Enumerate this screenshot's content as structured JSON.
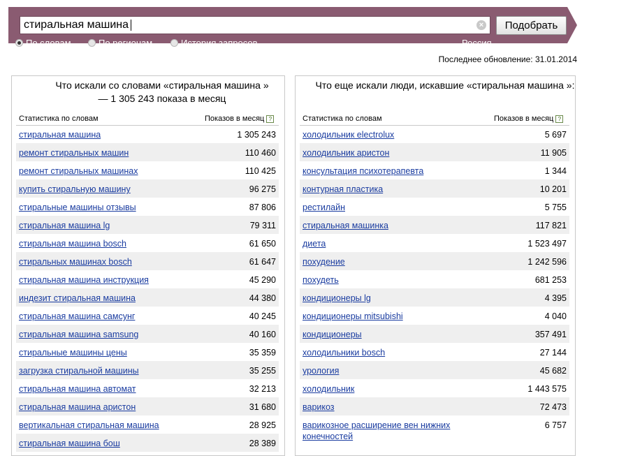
{
  "search": {
    "query": "стиральная машина",
    "submit_label": "Подобрать",
    "clear_glyph": "×",
    "modes": [
      {
        "label": "По словам",
        "checked": true
      },
      {
        "label": "По регионам",
        "checked": false
      },
      {
        "label": "История запросов",
        "checked": false
      }
    ],
    "region": "Россия"
  },
  "last_update": "Последнее обновление: 31.01.2014",
  "left_panel": {
    "title": "Что искали со словами «стиральная машина » — 1 305 243 показа в месяц",
    "col_words": "Статистика по словам",
    "col_count": "Показов в месяц",
    "help_glyph": "?",
    "rows": [
      {
        "phrase": "стиральная машина",
        "count": "1 305 243"
      },
      {
        "phrase": "ремонт стиральных машин",
        "count": "110 460"
      },
      {
        "phrase": "ремонт стиральных машинах",
        "count": "110 425"
      },
      {
        "phrase": "купить стиральную машину",
        "count": "96 275"
      },
      {
        "phrase": "стиральные машины отзывы",
        "count": "87 806"
      },
      {
        "phrase": "стиральная машина lg",
        "count": "79 311"
      },
      {
        "phrase": "стиральная машина bosch",
        "count": "61 650"
      },
      {
        "phrase": "стиральных машинах bosch",
        "count": "61 647"
      },
      {
        "phrase": "стиральная машина инструкция",
        "count": "45 290"
      },
      {
        "phrase": "индезит стиральная машина",
        "count": "44 380"
      },
      {
        "phrase": "стиральная машина самсунг",
        "count": "40 245"
      },
      {
        "phrase": "стиральная машина samsung",
        "count": "40 160"
      },
      {
        "phrase": "стиральные машины цены",
        "count": "35 359"
      },
      {
        "phrase": "загрузка стиральной машины",
        "count": "35 255"
      },
      {
        "phrase": "стиральная машина автомат",
        "count": "32 213"
      },
      {
        "phrase": "стиральная машина аристон",
        "count": "31 680"
      },
      {
        "phrase": "вертикальная стиральная машина",
        "count": "28 925"
      },
      {
        "phrase": "стиральная машина бош",
        "count": "28 389"
      }
    ]
  },
  "right_panel": {
    "title": "Что еще искали люди, искавшие «стиральная машина »:",
    "col_words": "Статистика по словам",
    "col_count": "Показов в месяц",
    "help_glyph": "?",
    "rows": [
      {
        "phrase": "холодильник electrolux",
        "count": "5 697"
      },
      {
        "phrase": "холодильник аристон",
        "count": "11 905"
      },
      {
        "phrase": "консультация психотерапевта",
        "count": "1 344"
      },
      {
        "phrase": "контурная пластика",
        "count": "10 201"
      },
      {
        "phrase": "рестилайн",
        "count": "5 755"
      },
      {
        "phrase": "стиральная машинка",
        "count": "117 821"
      },
      {
        "phrase": "диета",
        "count": "1 523 497"
      },
      {
        "phrase": "похудение",
        "count": "1 242 596"
      },
      {
        "phrase": "похудеть",
        "count": "681 253"
      },
      {
        "phrase": "кондиционеры lg",
        "count": "4 395"
      },
      {
        "phrase": "кондиционеры mitsubishi",
        "count": "4 040"
      },
      {
        "phrase": "кондиционеры",
        "count": "357 491"
      },
      {
        "phrase": "холодильники bosch",
        "count": "27 144"
      },
      {
        "phrase": "урология",
        "count": "45 682"
      },
      {
        "phrase": "холодильник",
        "count": "1 443 575"
      },
      {
        "phrase": "варикоз",
        "count": "72 473"
      },
      {
        "phrase": "варикозное расширение вен нижних конечностей",
        "count": "6 757"
      }
    ]
  }
}
